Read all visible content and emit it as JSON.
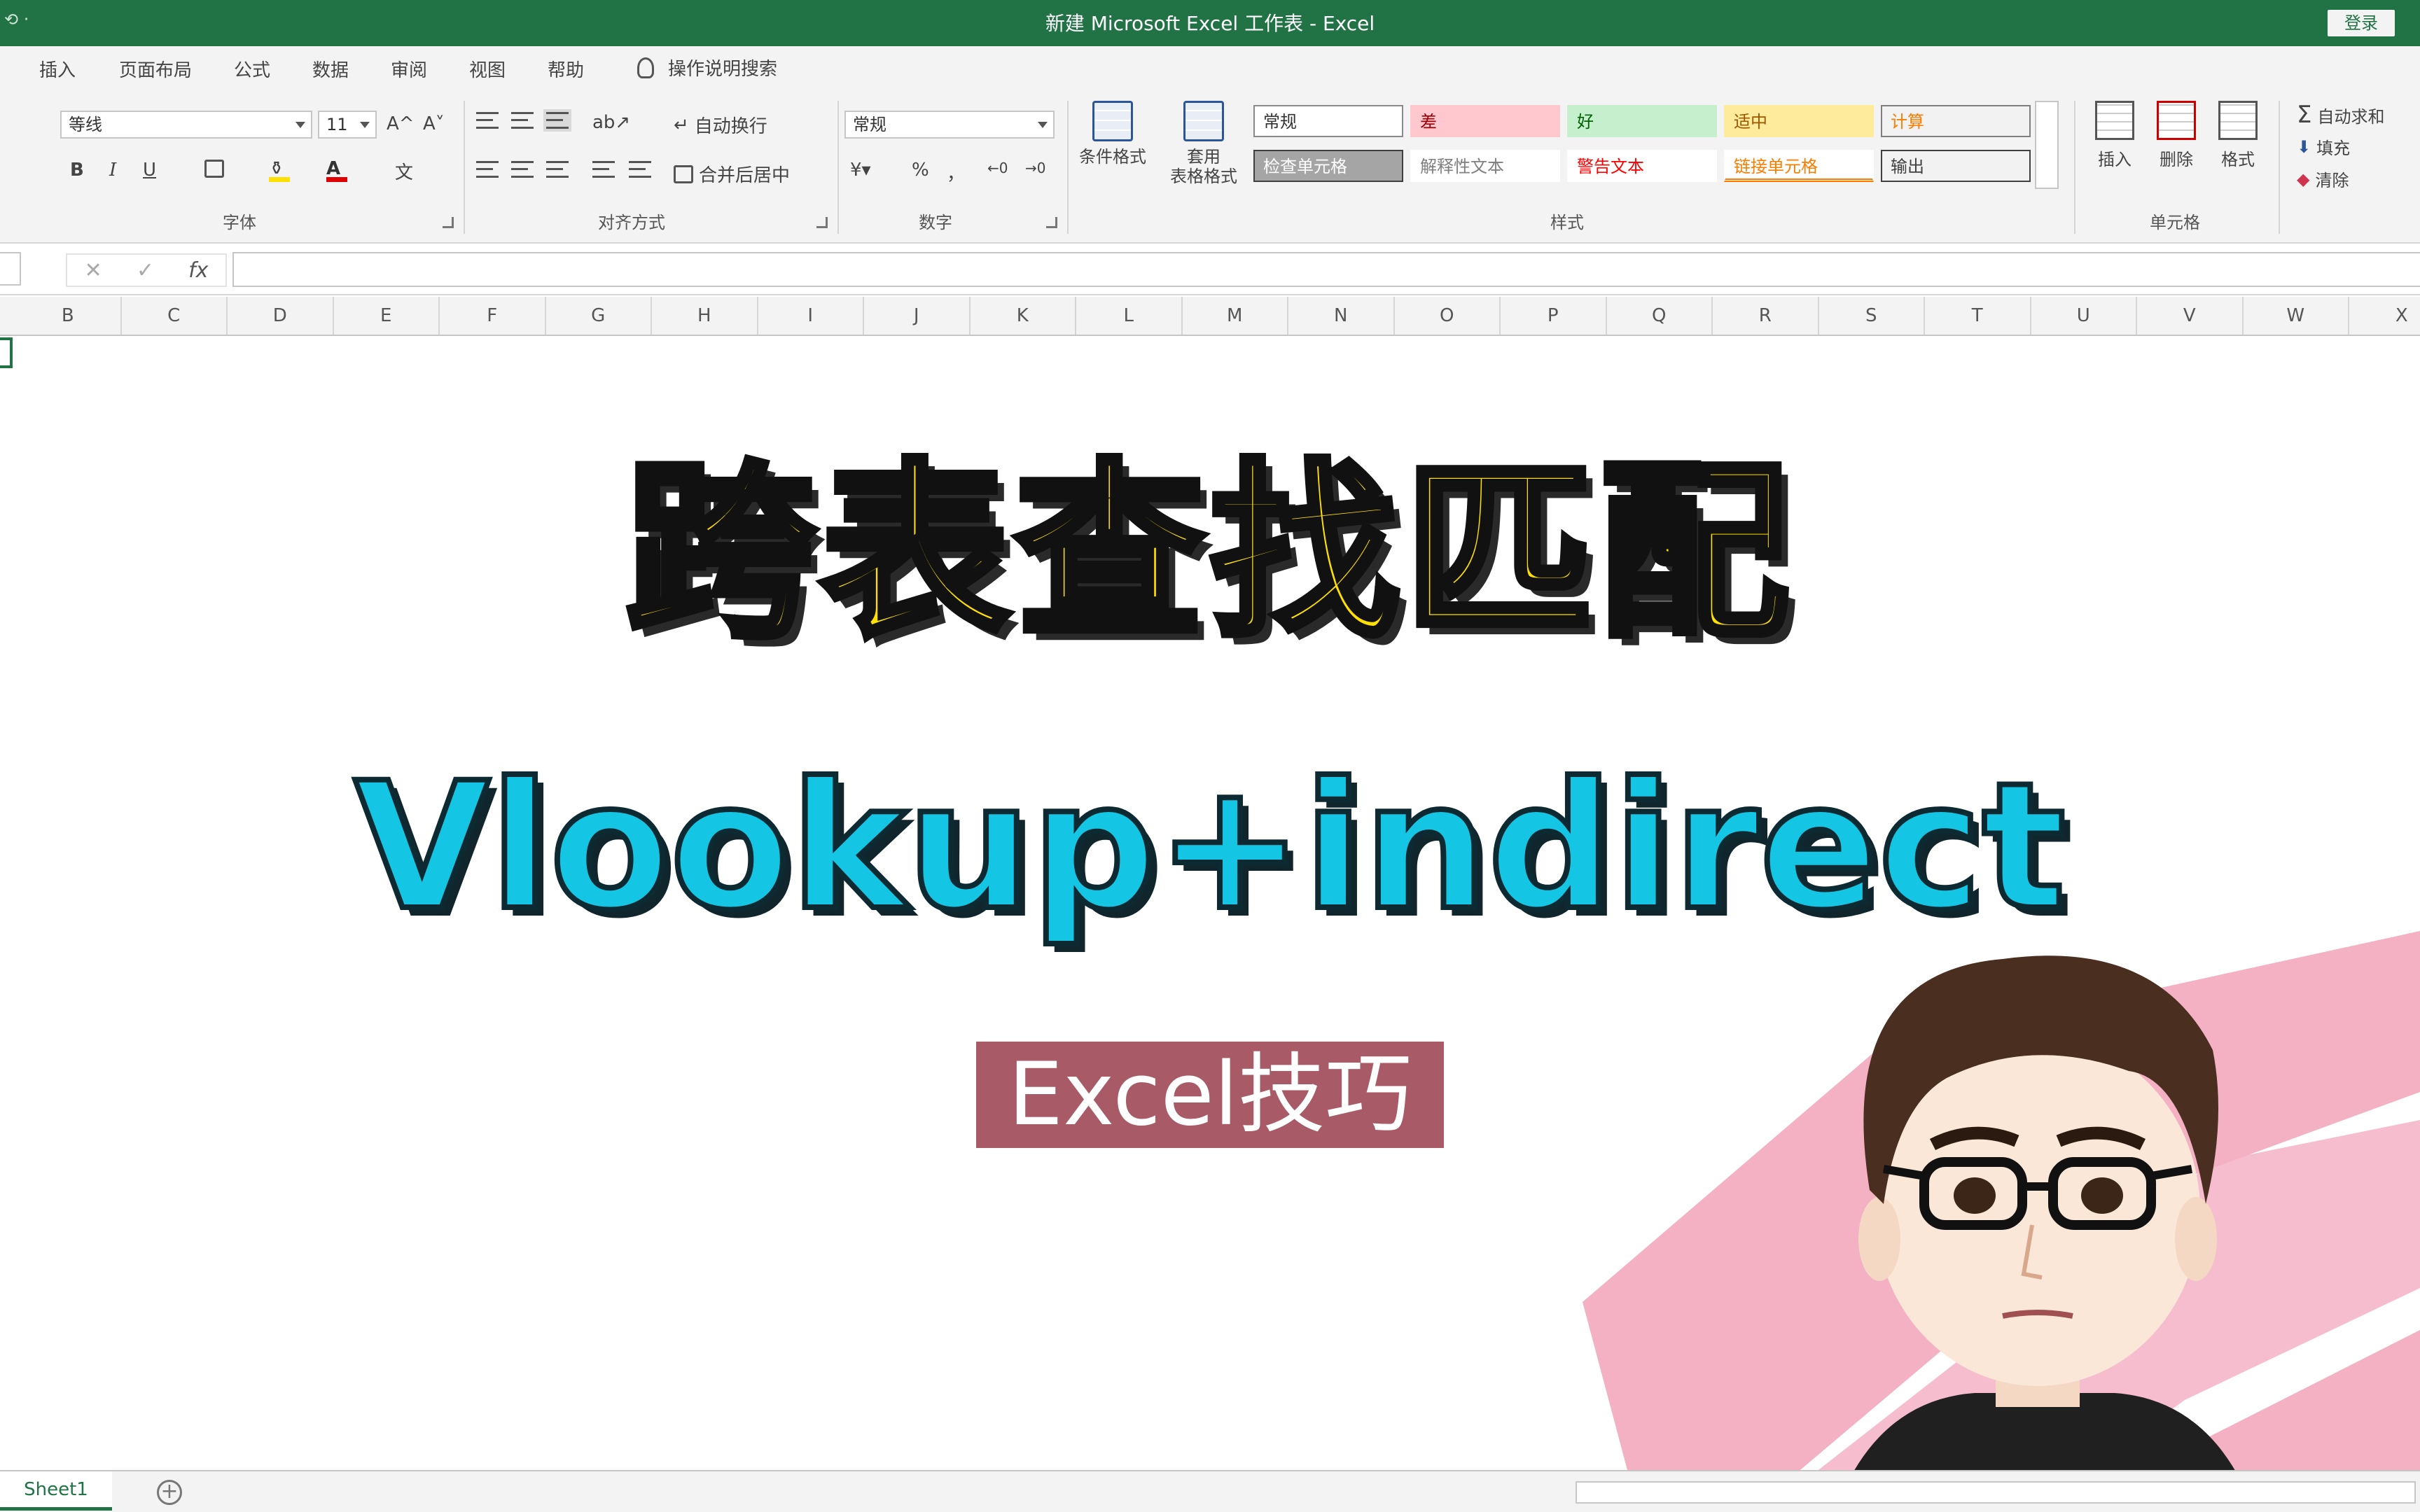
{
  "titlebar": {
    "quick_access": "⟲ ‧",
    "title": "新建 Microsoft Excel 工作表  -  Excel",
    "signin_label": "登录"
  },
  "ribbon_tabs": [
    "插入",
    "页面布局",
    "公式",
    "数据",
    "审阅",
    "视图",
    "帮助"
  ],
  "tell_me": "操作说明搜索",
  "font_group": {
    "font_name": "等线",
    "font_size": "11",
    "grow": "A^",
    "shrink": "A˅",
    "bold": "B",
    "italic": "I",
    "underline": "U",
    "label": "字体"
  },
  "alignment_group": {
    "wrap_text": "自动换行",
    "merge_center": "合并后居中",
    "label": "对齐方式"
  },
  "number_group": {
    "format": "常规",
    "percent": "%",
    "comma": "，",
    "label": "数字"
  },
  "styles_group": {
    "conditional_format": "条件格式",
    "table_format_1": "套用",
    "table_format_2": "表格格式",
    "cells": [
      {
        "label": "常规",
        "bg": "#ffffff",
        "fg": "#333333",
        "border": "#8a8a8a"
      },
      {
        "label": "差",
        "bg": "#ffc7ce",
        "fg": "#9c0006",
        "border": "#ffc7ce"
      },
      {
        "label": "好",
        "bg": "#c6efce",
        "fg": "#006100",
        "border": "#c6efce"
      },
      {
        "label": "适中",
        "bg": "#ffeb9c",
        "fg": "#9c5700",
        "border": "#ffeb9c"
      },
      {
        "label": "计算",
        "bg": "#f2f2f2",
        "fg": "#fa7d00",
        "border": "#7f7f7f"
      },
      {
        "label": "检查单元格",
        "bg": "#a5a5a5",
        "fg": "#ffffff",
        "border": "#3f3f3f"
      },
      {
        "label": "解释性文本",
        "bg": "#ffffff",
        "fg": "#7f7f7f",
        "border": "#ffffff"
      },
      {
        "label": "警告文本",
        "bg": "#ffffff",
        "fg": "#ff0000",
        "border": "#ffffff"
      },
      {
        "label": "链接单元格",
        "bg": "#ffffff",
        "fg": "#fa7d00",
        "border": "#ffffff"
      },
      {
        "label": "输出",
        "bg": "#f2f2f2",
        "fg": "#3f3f3f",
        "border": "#3f3f3f"
      }
    ],
    "label": "样式"
  },
  "cells_group": {
    "insert": "插入",
    "delete": "删除",
    "format": "格式",
    "label": "单元格"
  },
  "editing_group": {
    "autosum": "自动求和",
    "fill": "填充",
    "clear": "清除"
  },
  "formula_bar": {
    "cancel": "✕",
    "enter": "✓",
    "fx": "fx",
    "value": ""
  },
  "columns": [
    "B",
    "C",
    "D",
    "E",
    "F",
    "G",
    "H",
    "I",
    "J",
    "K",
    "L",
    "M",
    "N",
    "O",
    "P",
    "Q",
    "R",
    "S",
    "T",
    "U",
    "V",
    "W",
    "X"
  ],
  "content": {
    "headline": "跨表查找匹配",
    "subhead": "Vlookup+indirect",
    "tag": "Excel技巧"
  },
  "sheet_tabs": [
    "Sheet1"
  ],
  "add_sheet": "+",
  "colors": {
    "excel_green": "#217346",
    "headline_yellow": "#ffe000",
    "subhead_cyan": "#14c6e4",
    "tag_bg": "#a85a66",
    "brush_pink": "#f2a9bd"
  }
}
